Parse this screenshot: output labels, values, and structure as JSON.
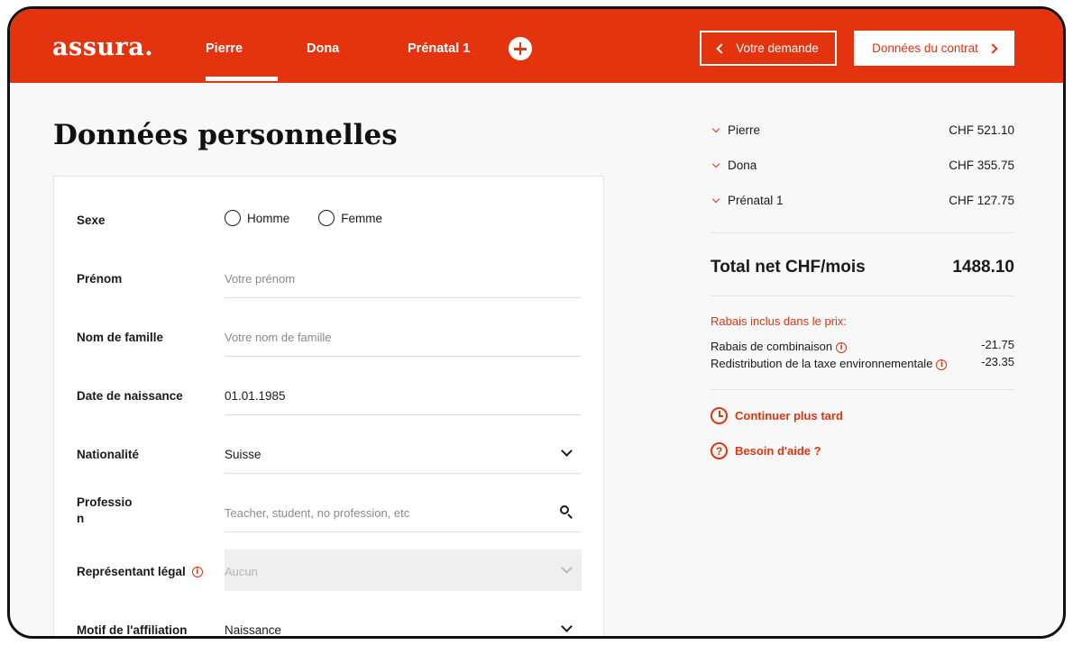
{
  "header": {
    "logo": "assura.",
    "tabs": [
      {
        "label": "Pierre",
        "active": true
      },
      {
        "label": "Dona",
        "active": false
      },
      {
        "label": "Prénatal 1",
        "active": false
      }
    ],
    "back_button": "Votre demande",
    "next_button": "Données du contrat",
    "accent_color": "#e3330f"
  },
  "page_title": "Données personnelles",
  "form": {
    "sexe": {
      "label": "Sexe",
      "options": [
        "Homme",
        "Femme"
      ]
    },
    "prenom": {
      "label": "Prénom",
      "placeholder": "Votre prénom"
    },
    "nom": {
      "label": "Nom de famille",
      "placeholder": "Votre nom de famille"
    },
    "naissance": {
      "label": "Date de naissance",
      "value": "01.01.1985"
    },
    "nationalite": {
      "label": "Nationalité",
      "value": "Suisse"
    },
    "profession": {
      "label_line1": "Professio",
      "label_line2": "n",
      "placeholder": "Teacher, student, no profession, etc"
    },
    "representant": {
      "label": "Représentant légal",
      "value": "Aucun"
    },
    "motif": {
      "label": "Motif de l'affiliation",
      "value": "Naissance"
    }
  },
  "summary": {
    "persons": [
      {
        "name": "Pierre",
        "amount": "CHF 521.10"
      },
      {
        "name": "Dona",
        "amount": "CHF 355.75"
      },
      {
        "name": "Prénatal 1",
        "amount": "CHF 127.75"
      }
    ],
    "total_label": "Total net CHF/mois",
    "total_value": "1488.10",
    "discounts_title": "Rabais inclus dans le prix:",
    "discounts": [
      {
        "label": "Rabais de combinaison",
        "amount": "-21.75"
      },
      {
        "label": "Redistribution de la taxe environnementale",
        "amount": "-23.35"
      }
    ],
    "continue_later": "Continuer plus tard",
    "help": "Besoin d'aide ?"
  }
}
